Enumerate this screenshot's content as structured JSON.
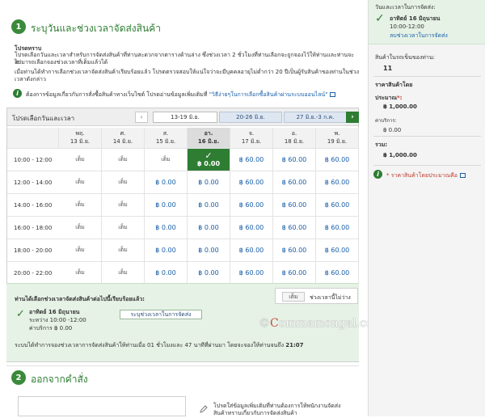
{
  "section1": {
    "number": "1",
    "title": "ระบุวันและช่วงเวลาจัดส่งสินค้า",
    "notice_heading": "โปรดทราบ",
    "notice_line1": "โปรดเลือกวันและเวลาสำหรับการจัดส่งสินค้าที่ท่านสะดวกจากตารางด้านล่าง ซึ่งช่วงเวลา 2 ชั่วโมงที่ท่านเลือกจะถูกจองไว้ให้ท่านและท่านจะไม่",
    "notice_line2": "สามารถเลือกจองช่วงเวลาที่เต็มแล้วได้",
    "notice_line3": "เมื่อท่านได้ทำการเลือกช่วงเวลาจัดส่งสินค้าเรียบร้อยแล้ว โปรดตรวจสอบให้แน่ใจว่าจะมีบุคคลอายุไม่ต่ำกว่า 20 ปีเป็นผู้รับสินค้าของท่านในช่วง",
    "notice_line4": "เวลาดังกล่าว",
    "info_text": "ต้องการข้อมูลเกี่ยวกับการสั่งซื้อสินค้าทางเว็บไซต์ โปรดอ่านข้อมูลเพิ่มเติมที่ ",
    "info_link": "\"วิธีง่ายๆในการเลือกซื้อสินค้าผ่านระบบออนไลน์\""
  },
  "slots": {
    "header_label": "โปรดเลือกวันและเวลา",
    "prev_label": "‹",
    "ranges": [
      "13-19 มิ.ย.",
      "20-26 มิ.ย.",
      "27 มิ.ย.-3 ก.ค."
    ],
    "next_label": "›",
    "days": [
      {
        "dow": "พฤ.",
        "date": "13 มิ.ย."
      },
      {
        "dow": "ศ.",
        "date": "14 มิ.ย."
      },
      {
        "dow": "ส.",
        "date": "15 มิ.ย."
      },
      {
        "dow": "อา.",
        "date": "16 มิ.ย."
      },
      {
        "dow": "จ.",
        "date": "17 มิ.ย."
      },
      {
        "dow": "อ.",
        "date": "18 มิ.ย."
      },
      {
        "dow": "พ.",
        "date": "19 มิ.ย."
      }
    ],
    "times": [
      "10:00 - 12:00",
      "12:00 - 14:00",
      "14:00 - 16:00",
      "16:00 - 18:00",
      "18:00 - 20:00",
      "20:00 - 22:00"
    ],
    "rows": [
      [
        "เต็ม",
        "เต็ม",
        "เต็ม",
        "฿ 0.00",
        "฿ 60.00",
        "฿ 60.00",
        "฿ 60.00"
      ],
      [
        "เต็ม",
        "เต็ม",
        "฿ 0.00",
        "฿ 0.00",
        "฿ 60.00",
        "฿ 60.00",
        "฿ 60.00"
      ],
      [
        "เต็ม",
        "เต็ม",
        "฿ 0.00",
        "฿ 0.00",
        "฿ 60.00",
        "฿ 60.00",
        "฿ 60.00"
      ],
      [
        "เต็ม",
        "เต็ม",
        "฿ 0.00",
        "฿ 0.00",
        "฿ 60.00",
        "฿ 60.00",
        "฿ 60.00"
      ],
      [
        "เต็ม",
        "เต็ม",
        "฿ 0.00",
        "฿ 0.00",
        "฿ 60.00",
        "฿ 60.00",
        "฿ 60.00"
      ],
      [
        "เต็ม",
        "เต็ม",
        "฿ 0.00",
        "฿ 0.00",
        "฿ 60.00",
        "฿ 60.00",
        "฿ 60.00"
      ]
    ],
    "chosen_check": "✓",
    "full_label": "เต็ม",
    "legend_full": "เต็ม",
    "legend_text": "ช่วงเวลานี้ไม่ว่าง"
  },
  "summary": {
    "question": "ท่านได้เลือกช่วงเวลาจัดส่งสินค้าต่อไปนี้เรียบร้อยแล้ว:",
    "date": "อาทิตย์ 16 มิถุนายน",
    "time": "ระหว่าง 10:00 -12:00",
    "fee": "ค่าบริการ ฿ 0.00",
    "button": "ระบุช่วงเวลาในการจัดส่ง",
    "footer_a": "ระบบได้ทำการจองช่วงเวลาการจัดส่งสินค้าให้ท่านเมื่อ 01 ชั่วโมงและ 47 นาทีที่ผ่านมา โดยจะจองให้ท่านจนถึง ",
    "footer_b": "21:07"
  },
  "section2": {
    "number": "2",
    "title": "ออกจากคำสั่ง",
    "hint_line1": "โปรดใส่ข้อมูลเพิ่มเติมที่ท่านต้องการให้พนักงานจัดส่ง",
    "hint_line2": "สินค้าทราบเกี่ยวกับการจัดส่งสินค้า"
  },
  "sidebar": {
    "heading": "วันและเวลาในการจัดส่ง:",
    "date": "อาทิตย์ 16 มิถุนายน",
    "time": "10:00-12:00",
    "link": "ลบช่วงเวลาในการจัดส่ง",
    "items_label": "สินค้าในรถเข็นของท่าน:",
    "items_count": "11",
    "price_label": "ราคาสินค้าโดย",
    "estimate_label": "ประมาณ",
    "asterisk": "*:",
    "estimate_value": "฿ 1,000.00",
    "service_label": "ค่าบริการ:",
    "service_value": "฿ 0.00",
    "total_label": "รวม:",
    "total_value": "฿ 1,000.00",
    "note": "* ราคาสินค้าโดยประมาณคือ"
  },
  "watermark": {
    "letter": "C",
    "rest": "ommamongal.com",
    "prefix": "©"
  },
  "colors": {
    "accent_green": "#2e7d32",
    "link_blue": "#1a5fa8",
    "summary_bg": "#e6f2e6"
  }
}
